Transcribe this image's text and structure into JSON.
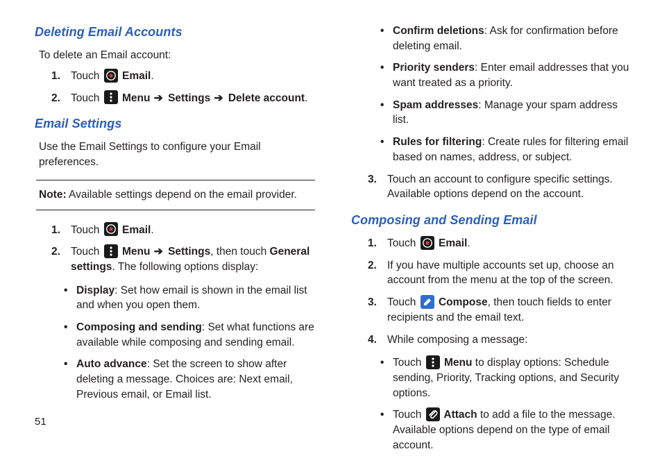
{
  "page_number": "51",
  "left": {
    "h_delete": "Deleting Email Accounts",
    "delete_intro": "To delete an Email account:",
    "delete_steps": {
      "s1": {
        "num": "1.",
        "a": "Touch ",
        "b": " Email",
        "c": "."
      },
      "s2": {
        "num": "2.",
        "a": "Touch ",
        "b": " Menu ",
        "arrow1": "➔",
        "c": " Settings ",
        "arrow2": "➔",
        "d": " Delete account",
        "e": "."
      }
    },
    "h_settings": "Email Settings",
    "settings_intro": "Use the Email Settings to configure your Email preferences.",
    "note": {
      "label": "Note:",
      "text": " Available settings depend on the email provider."
    },
    "settings_steps": {
      "s1": {
        "num": "1.",
        "a": "Touch ",
        "b": " Email",
        "c": "."
      },
      "s2": {
        "num": "2.",
        "a": "Touch ",
        "b": " Menu ",
        "arrow1": "➔",
        "c": " Settings",
        "d": ", then touch ",
        "e": "General settings",
        "f": ". The following options display:"
      }
    },
    "opts": {
      "display": {
        "t": "Display",
        "d": ": Set how email is shown in the email list and when you open them."
      },
      "compose": {
        "t": "Composing and sending",
        "d": ": Set what functions are available while composing and sending email."
      },
      "auto": {
        "t": "Auto advance",
        "d": ": Set the screen to show after deleting a message. Choices are: Next email, Previous email, or Email list."
      }
    }
  },
  "right": {
    "opts2": {
      "confirm": {
        "t": "Confirm deletions",
        "d": ": Ask for confirmation before deleting email."
      },
      "priority": {
        "t": "Priority senders",
        "d": ": Enter email addresses that you want treated as a priority."
      },
      "spam": {
        "t": "Spam addresses",
        "d": ": Manage your spam address list."
      },
      "rules": {
        "t": "Rules for filtering",
        "d": ": Create rules for filtering email based on names, address, or subject."
      }
    },
    "step3": {
      "num": "3.",
      "text": "Touch an account to configure specific settings. Available options depend on the account."
    },
    "h_compose": "Composing and Sending Email",
    "compose_steps": {
      "s1": {
        "num": "1.",
        "a": "Touch ",
        "b": " Email",
        "c": "."
      },
      "s2": {
        "num": "2.",
        "text": "If you have multiple accounts set up, choose an account from the menu at the top of the screen."
      },
      "s3": {
        "num": "3.",
        "a": "Touch ",
        "b": " Compose",
        "c": ", then touch fields to enter recipients and the email text."
      },
      "s4": {
        "num": "4.",
        "text": "While composing a message:"
      }
    },
    "sub": {
      "menu": {
        "a": "Touch ",
        "b": " Menu",
        "c": " to display options: Schedule sending, Priority, Tracking options, and Security options."
      },
      "attach": {
        "a": "Touch ",
        "b": " Attach",
        "c": " to add a file to the message. Available options depend on the type of email account."
      }
    }
  }
}
